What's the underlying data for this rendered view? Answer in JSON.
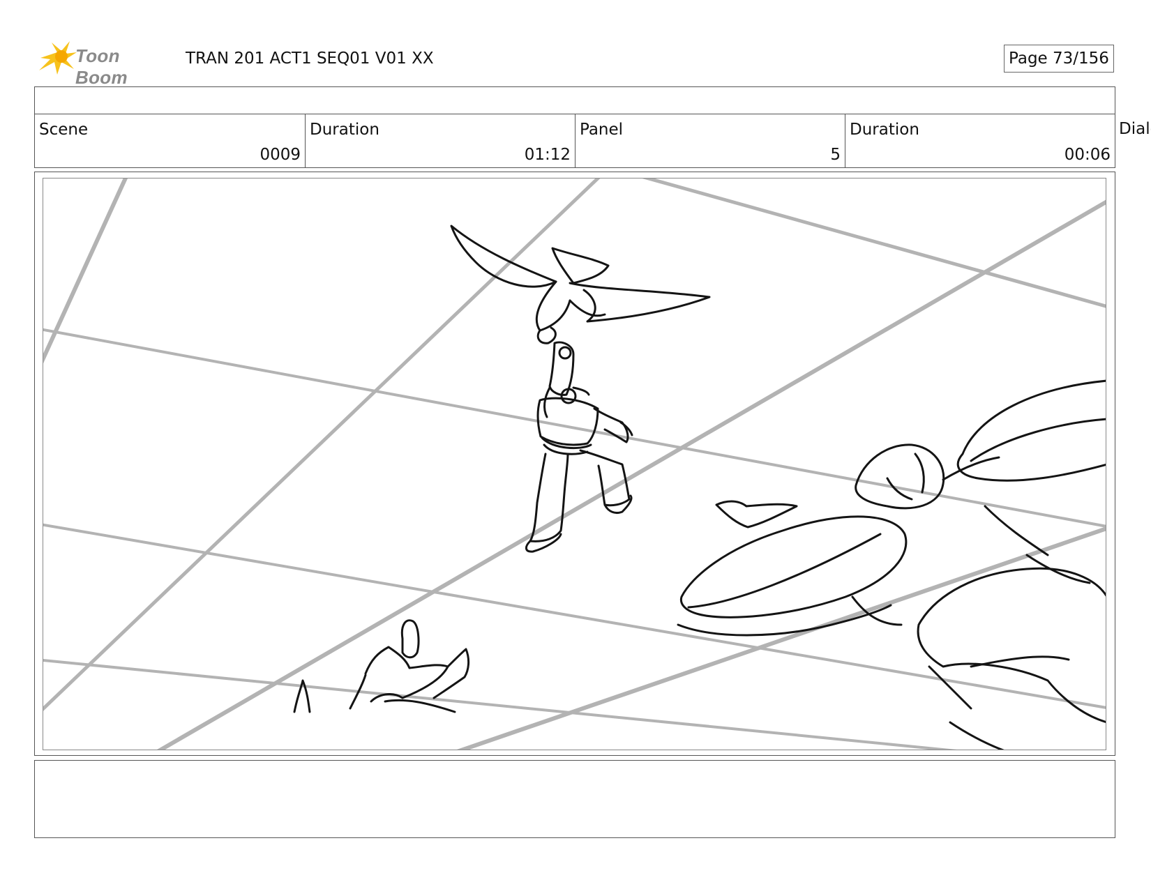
{
  "header": {
    "logo_text": "Toon Boom",
    "project_title": "TRAN 201 ACT1 SEQ01 V01 XX",
    "page_label": "Page  73/156"
  },
  "info": {
    "scene_label": "Scene",
    "scene_value": "0009",
    "scene_duration_label": "Duration",
    "scene_duration_value": "01:12",
    "panel_label": "Panel",
    "panel_value": "5",
    "panel_duration_label": "Duration",
    "panel_duration_value": "00:06",
    "dialog_label": "Dialo"
  },
  "colors": {
    "logo_flare": "#f5b800",
    "grid_lines": "#b3b3b3",
    "sketch_ink": "#141414",
    "borders": "#555555"
  },
  "icons": {
    "logo": "toon-boom-flare-icon"
  }
}
